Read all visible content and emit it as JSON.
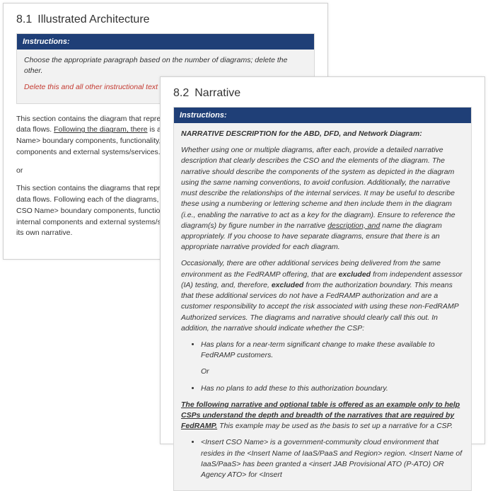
{
  "pageA": {
    "heading_num": "8.1",
    "heading_text": "Illustrated Architecture",
    "instr_label": "Instructions:",
    "instr_line1": "Choose the appropriate paragraph based on the number of diagrams; delete the other.",
    "instr_line2": "Delete this and all other instructional text from your final version of this document.",
    "para1a": "This section contains the diagram that represents the authorization boundary, network, and data flows. ",
    "para1b": "Following the diagram, there",
    "para1c": " is a narrative that describes the <Insert CSO Name> boundary components, functionality, as well as the interactions between its internal components and external systems/services.",
    "or": "or",
    "para2": "This section contains the diagrams that represent the authorization boundary, network, and data flows. Following each of the diagrams, there is a narrative that describes the <Insert CSO Name> boundary components, functionality, as well as the interactions between its internal components and external systems/services. If using separate diagrams, each has its own narrative."
  },
  "pageB": {
    "heading_num": "8.2",
    "heading_text": "Narrative",
    "instr_label": "Instructions:",
    "narr_title": "NARRATIVE DESCRIPTION for the ABD, DFD, and Network Diagram:",
    "p1a": "Whether using one or multiple diagrams, after each, provide a detailed narrative description that clearly describes the CSO and the elements of the diagram. The narrative should describe the components of the system as depicted in the diagram using the same naming conventions, to avoid confusion. Additionally, the narrative must describe the relationships of the internal services. It may be useful to describe these using a numbering or lettering scheme and then include them in the diagram (i.e., enabling the narrative to act as a key for the diagram). Ensure to reference the diagram(s) by figure number in the narrative ",
    "p1b": "description, and",
    "p1c": " name the diagram appropriately. If you choose to have separate diagrams, ensure that there is an appropriate narrative provided for each diagram.",
    "p2a": "Occasionally, there are other additional services being delivered from the same environment as the FedRAMP offering, that are ",
    "p2b": "excluded",
    "p2c": " from independent assessor (IA) testing, and, therefore, ",
    "p2d": "excluded",
    "p2e": " from the authorization boundary. This means that these additional services do not have a FedRAMP authorization and are a customer responsibility to accept the risk associated with using these non-FedRAMP Authorized services. The diagrams and narrative should clearly call this out. In addition, the narrative should indicate whether the CSP:",
    "bullet1": "Has plans for a near-term significant change to make these available to FedRAMP customers.",
    "bullet_or": "Or",
    "bullet2": "Has no plans to add these to this authorization boundary.",
    "p3a": "The following narrative and optional table is offered as an example only to help CSPs understand the depth and breadth of the narratives that are required by FedRAMP.",
    "p3b": " This example may be used as the basis to set up a narrative for a CSP.",
    "bullet3": "<Insert CSO Name> is a government-community cloud environment that resides in the <Insert Name of IaaS/PaaS and Region> region. <Insert Name of IaaS/PaaS> has been granted a <insert JAB Provisional ATO (P-ATO) OR Agency ATO> for <Insert"
  }
}
